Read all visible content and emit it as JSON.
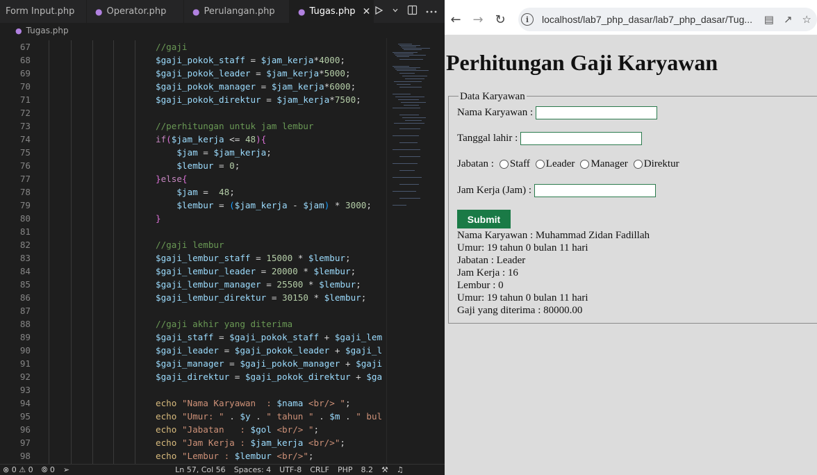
{
  "tabs": [
    {
      "label": "Form Input.php",
      "active": false
    },
    {
      "label": "Operator.php",
      "active": false
    },
    {
      "label": "Perulangan.php",
      "active": false
    },
    {
      "label": "Tugas.php",
      "active": true
    }
  ],
  "breadcrumb": "Tugas.php",
  "code_lines": [
    {
      "n": "67",
      "tokens": [
        [
          "c-com",
          "//gaji"
        ]
      ]
    },
    {
      "n": "68",
      "tokens": [
        [
          "c-var",
          "$gaji_pokok_staff"
        ],
        [
          "",
          " = "
        ],
        [
          "c-var",
          "$jam_kerja"
        ],
        [
          "",
          "*"
        ],
        [
          "c-num",
          "4000"
        ],
        [
          "",
          ";"
        ]
      ]
    },
    {
      "n": "69",
      "tokens": [
        [
          "c-var",
          "$gaji_pokok_leader"
        ],
        [
          "",
          " = "
        ],
        [
          "c-var",
          "$jam_kerja"
        ],
        [
          "",
          "*"
        ],
        [
          "c-num",
          "5000"
        ],
        [
          "",
          ";"
        ]
      ]
    },
    {
      "n": "70",
      "tokens": [
        [
          "c-var",
          "$gaji_pokok_manager"
        ],
        [
          "",
          " = "
        ],
        [
          "c-var",
          "$jam_kerja"
        ],
        [
          "",
          "*"
        ],
        [
          "c-num",
          "6000"
        ],
        [
          "",
          ";"
        ]
      ]
    },
    {
      "n": "71",
      "tokens": [
        [
          "c-var",
          "$gaji_pokok_direktur"
        ],
        [
          "",
          " = "
        ],
        [
          "c-var",
          "$jam_kerja"
        ],
        [
          "",
          "*"
        ],
        [
          "c-num",
          "7500"
        ],
        [
          "",
          ";"
        ]
      ]
    },
    {
      "n": "72",
      "tokens": []
    },
    {
      "n": "73",
      "tokens": [
        [
          "c-com",
          "//perhitungan untuk jam lembur"
        ]
      ]
    },
    {
      "n": "74",
      "tokens": [
        [
          "c-kw",
          "if"
        ],
        [
          "c-br1",
          "("
        ],
        [
          "c-var",
          "$jam_kerja"
        ],
        [
          "",
          " <= "
        ],
        [
          "c-num",
          "48"
        ],
        [
          "c-br1",
          ")"
        ],
        [
          "c-br1",
          "{"
        ]
      ]
    },
    {
      "n": "75",
      "tokens": [
        [
          "",
          "    "
        ],
        [
          "c-var",
          "$jam"
        ],
        [
          "",
          " = "
        ],
        [
          "c-var",
          "$jam_kerja"
        ],
        [
          "",
          ";"
        ]
      ]
    },
    {
      "n": "76",
      "tokens": [
        [
          "",
          "    "
        ],
        [
          "c-var",
          "$lembur"
        ],
        [
          "",
          " = "
        ],
        [
          "c-num",
          "0"
        ],
        [
          "",
          ";"
        ]
      ]
    },
    {
      "n": "77",
      "tokens": [
        [
          "c-br1",
          "}"
        ],
        [
          "c-kw",
          "else"
        ],
        [
          "c-br1",
          "{"
        ]
      ]
    },
    {
      "n": "78",
      "tokens": [
        [
          "",
          "    "
        ],
        [
          "c-var",
          "$jam"
        ],
        [
          "",
          " =  "
        ],
        [
          "c-num",
          "48"
        ],
        [
          "",
          ";"
        ]
      ]
    },
    {
      "n": "79",
      "tokens": [
        [
          "",
          "    "
        ],
        [
          "c-var",
          "$lembur"
        ],
        [
          "",
          " = "
        ],
        [
          "c-br2",
          "("
        ],
        [
          "c-var",
          "$jam_kerja"
        ],
        [
          "",
          " - "
        ],
        [
          "c-var",
          "$jam"
        ],
        [
          "c-br2",
          ")"
        ],
        [
          "",
          " * "
        ],
        [
          "c-num",
          "3000"
        ],
        [
          "",
          ";"
        ]
      ]
    },
    {
      "n": "80",
      "tokens": [
        [
          "c-br1",
          "}"
        ]
      ]
    },
    {
      "n": "81",
      "tokens": []
    },
    {
      "n": "82",
      "tokens": [
        [
          "c-com",
          "//gaji lembur"
        ]
      ]
    },
    {
      "n": "83",
      "tokens": [
        [
          "c-var",
          "$gaji_lembur_staff"
        ],
        [
          "",
          " = "
        ],
        [
          "c-num",
          "15000"
        ],
        [
          "",
          " * "
        ],
        [
          "c-var",
          "$lembur"
        ],
        [
          "",
          ";"
        ]
      ]
    },
    {
      "n": "84",
      "tokens": [
        [
          "c-var",
          "$gaji_lembur_leader"
        ],
        [
          "",
          " = "
        ],
        [
          "c-num",
          "20000"
        ],
        [
          "",
          " * "
        ],
        [
          "c-var",
          "$lembur"
        ],
        [
          "",
          ";"
        ]
      ]
    },
    {
      "n": "85",
      "tokens": [
        [
          "c-var",
          "$gaji_lembur_manager"
        ],
        [
          "",
          " = "
        ],
        [
          "c-num",
          "25500"
        ],
        [
          "",
          " * "
        ],
        [
          "c-var",
          "$lembur"
        ],
        [
          "",
          ";"
        ]
      ]
    },
    {
      "n": "86",
      "tokens": [
        [
          "c-var",
          "$gaji_lembur_direktur"
        ],
        [
          "",
          " = "
        ],
        [
          "c-num",
          "30150"
        ],
        [
          "",
          " * "
        ],
        [
          "c-var",
          "$lembur"
        ],
        [
          "",
          ";"
        ]
      ]
    },
    {
      "n": "87",
      "tokens": []
    },
    {
      "n": "88",
      "tokens": [
        [
          "c-com",
          "//gaji akhir yang diterima"
        ]
      ]
    },
    {
      "n": "89",
      "tokens": [
        [
          "c-var",
          "$gaji_staff"
        ],
        [
          "",
          " = "
        ],
        [
          "c-var",
          "$gaji_pokok_staff"
        ],
        [
          "",
          " + "
        ],
        [
          "c-var",
          "$gaji_lem"
        ]
      ]
    },
    {
      "n": "90",
      "tokens": [
        [
          "c-var",
          "$gaji_leader"
        ],
        [
          "",
          " = "
        ],
        [
          "c-var",
          "$gaji_pokok_leader"
        ],
        [
          "",
          " + "
        ],
        [
          "c-var",
          "$gaji_l"
        ]
      ]
    },
    {
      "n": "91",
      "tokens": [
        [
          "c-var",
          "$gaji_manager"
        ],
        [
          "",
          " = "
        ],
        [
          "c-var",
          "$gaji_pokok_manager"
        ],
        [
          "",
          " + "
        ],
        [
          "c-var",
          "$gaji"
        ]
      ]
    },
    {
      "n": "92",
      "tokens": [
        [
          "c-var",
          "$gaji_direktur"
        ],
        [
          "",
          " = "
        ],
        [
          "c-var",
          "$gaji_pokok_direktur"
        ],
        [
          "",
          " + "
        ],
        [
          "c-var",
          "$ga"
        ]
      ]
    },
    {
      "n": "93",
      "tokens": []
    },
    {
      "n": "94",
      "tokens": [
        [
          "c-ech",
          "echo"
        ],
        [
          "",
          " "
        ],
        [
          "c-str",
          "\"Nama Karyawan  : "
        ],
        [
          "c-var",
          "$nama"
        ],
        [
          "c-str",
          " <br/> \""
        ],
        [
          "",
          ";"
        ]
      ]
    },
    {
      "n": "95",
      "tokens": [
        [
          "c-ech",
          "echo"
        ],
        [
          "",
          " "
        ],
        [
          "c-str",
          "\"Umur: \""
        ],
        [
          "",
          " . "
        ],
        [
          "c-var",
          "$y"
        ],
        [
          "",
          " . "
        ],
        [
          "c-str",
          "\" tahun \""
        ],
        [
          "",
          " . "
        ],
        [
          "c-var",
          "$m"
        ],
        [
          "",
          " . "
        ],
        [
          "c-str",
          "\" bul"
        ]
      ]
    },
    {
      "n": "96",
      "tokens": [
        [
          "c-ech",
          "echo"
        ],
        [
          "",
          " "
        ],
        [
          "c-str",
          "\"Jabatan   : "
        ],
        [
          "c-var",
          "$gol"
        ],
        [
          "c-str",
          " <br/> \""
        ],
        [
          "",
          ";"
        ]
      ]
    },
    {
      "n": "97",
      "tokens": [
        [
          "c-ech",
          "echo"
        ],
        [
          "",
          " "
        ],
        [
          "c-str",
          "\"Jam Kerja : "
        ],
        [
          "c-var",
          "$jam_kerja"
        ],
        [
          "c-str",
          " <br/>\""
        ],
        [
          "",
          ";"
        ]
      ]
    },
    {
      "n": "98",
      "tokens": [
        [
          "c-ech",
          "echo"
        ],
        [
          "",
          " "
        ],
        [
          "c-str",
          "\"Lembur : "
        ],
        [
          "c-var",
          "$lembur"
        ],
        [
          "c-str",
          " <br/>\""
        ],
        [
          "",
          ";"
        ]
      ]
    }
  ],
  "statusbar": {
    "errors": "0",
    "warnings": "0",
    "ports": "0",
    "cursor": "Ln 57, Col 56",
    "spaces": "Spaces: 4",
    "encoding": "UTF-8",
    "eol": "CRLF",
    "language": "PHP",
    "php_version": "8.2"
  },
  "browser": {
    "url": "localhost/lab7_php_dasar/lab7_php_dasar/Tug..."
  },
  "page": {
    "title": "Perhitungan Gaji Karyawan",
    "legend": "Data Karyawan",
    "label_nama": "Nama Karyawan :",
    "label_tgl": "Tanggal lahir :",
    "label_jabatan": "Jabatan :",
    "radio_options": [
      "Staff",
      "Leader",
      "Manager",
      "Direktur"
    ],
    "label_jam": "Jam Kerja (Jam) :",
    "submit_label": "Submit",
    "results": [
      "Nama Karyawan : Muhammad Zidan Fadillah",
      "Umur: 19 tahun 0 bulan 11 hari",
      "Jabatan : Leader",
      "Jam Kerja : 16",
      "Lembur : 0",
      "Umur: 19 tahun 0 bulan 11 hari",
      "Gaji yang diterima : 80000.00"
    ]
  },
  "colors": {
    "editor_bg": "#1e1e1e",
    "page_bg": "#dcdcdc",
    "submit_bg": "#1a7a46",
    "php_icon": "#b181e0"
  },
  "icons": {
    "tab": "php-elephant-icon",
    "run": "play-icon",
    "split": "split-editor-icon",
    "more": "more-icon",
    "back": "back-arrow-icon",
    "forward": "forward-arrow-icon",
    "reload": "reload-icon",
    "info": "info-icon",
    "translate": "translate-icon",
    "share": "share-icon",
    "bookmark": "star-icon"
  }
}
